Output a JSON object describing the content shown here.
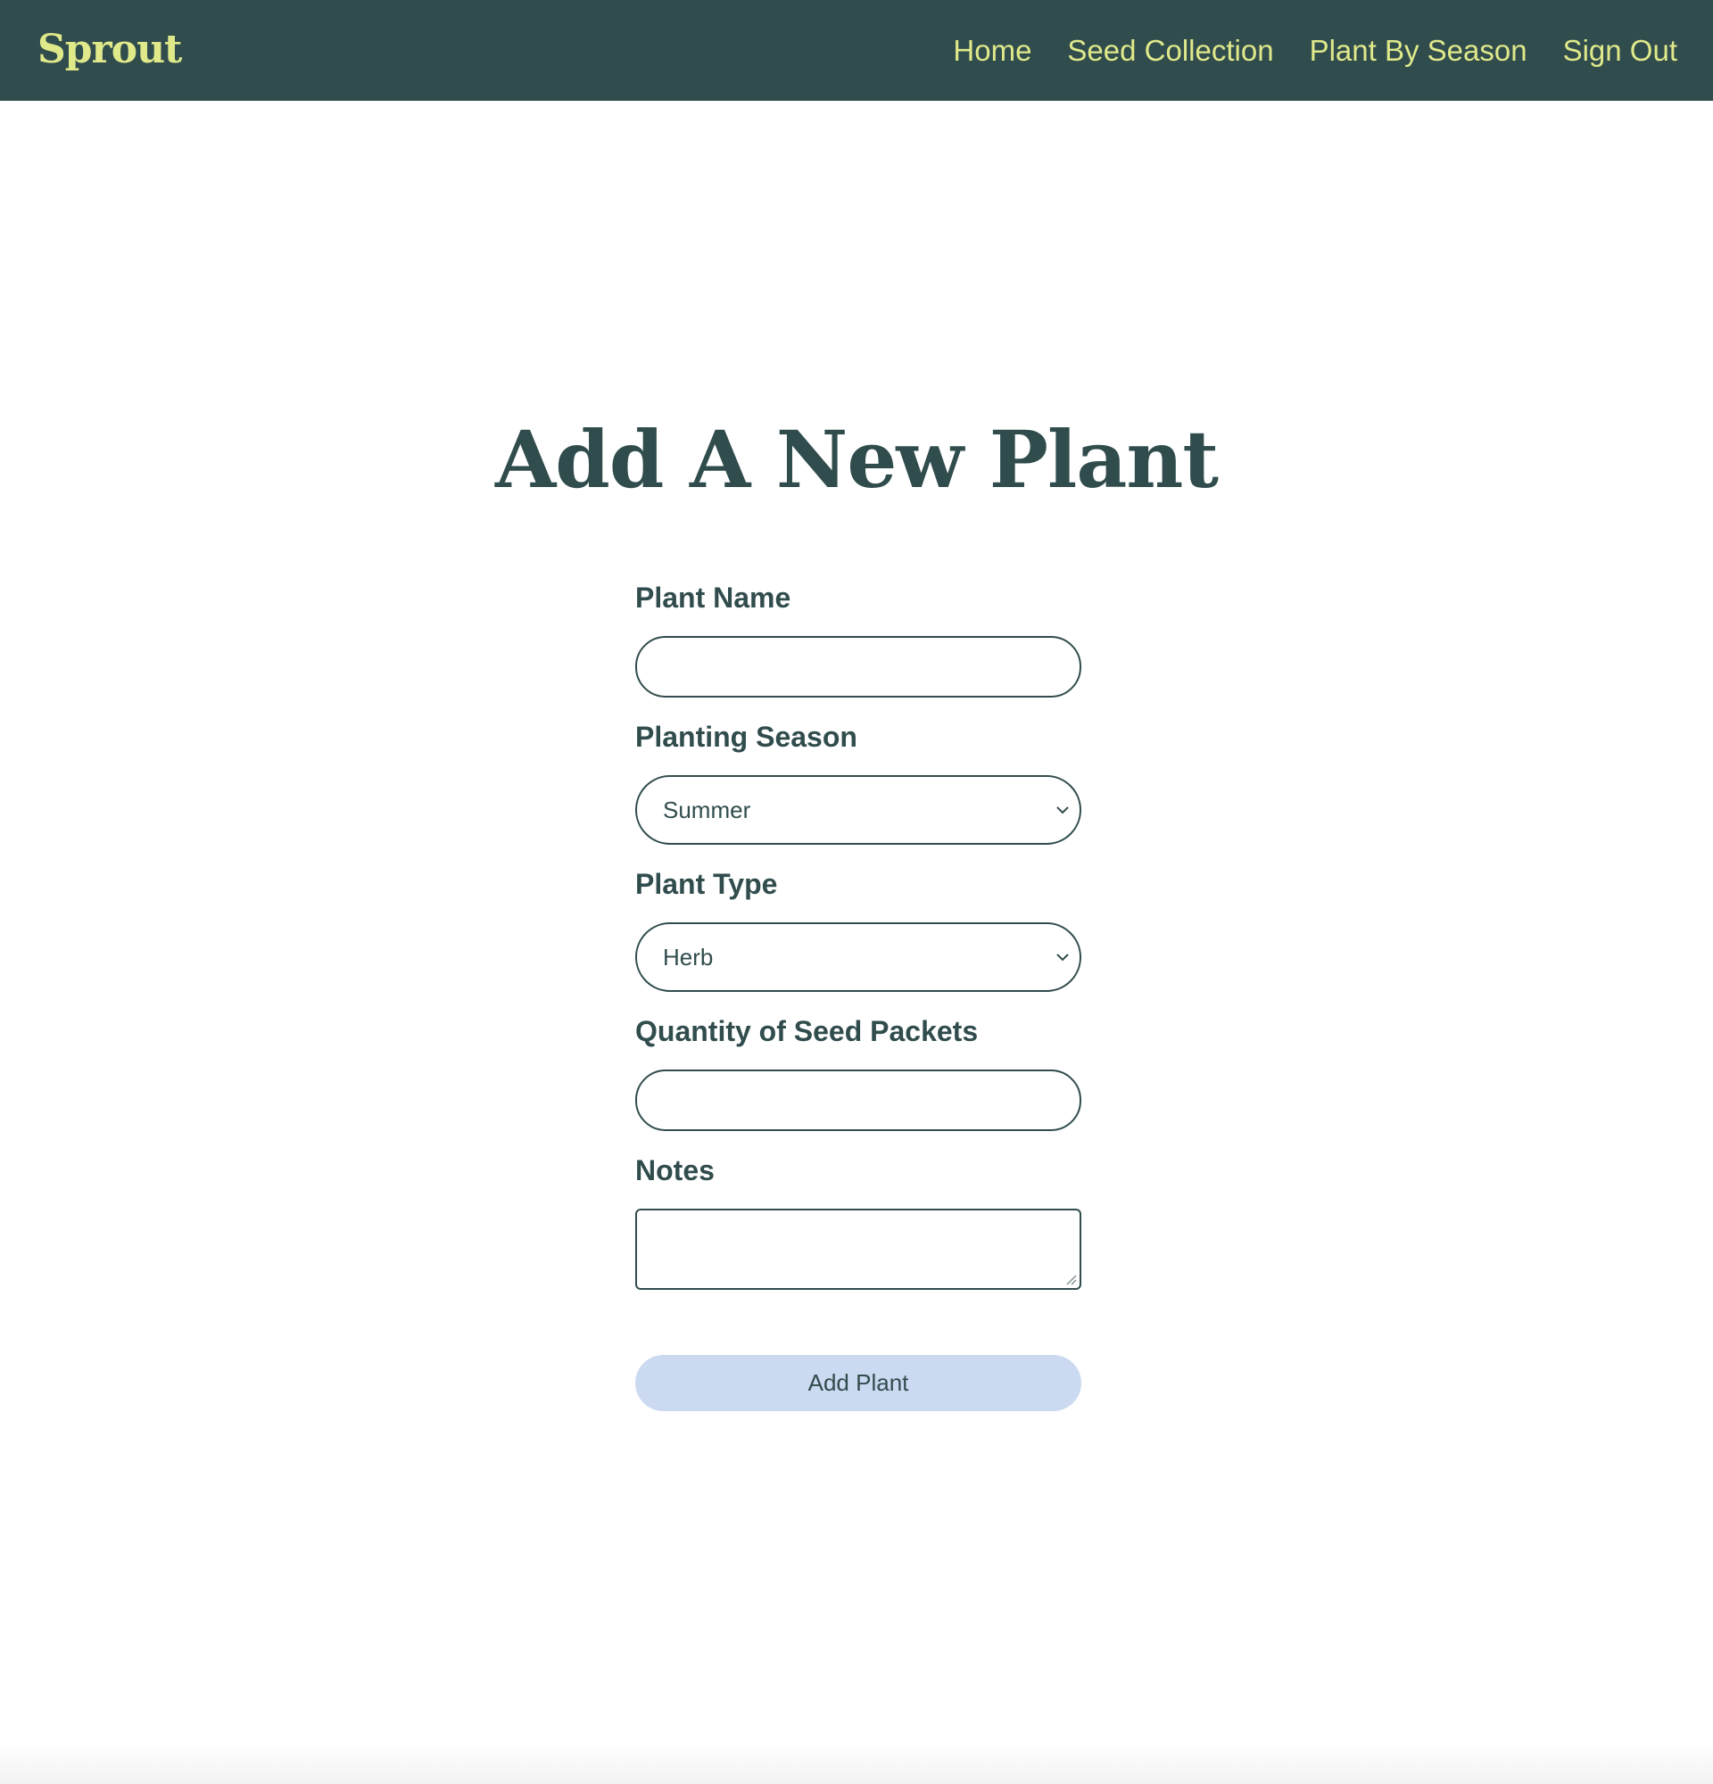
{
  "navbar": {
    "brand": "Sprout",
    "links": [
      "Home",
      "Seed Collection",
      "Plant By Season",
      "Sign Out"
    ]
  },
  "page": {
    "title": "Add A New Plant"
  },
  "form": {
    "plant_name": {
      "label": "Plant Name",
      "value": ""
    },
    "planting_season": {
      "label": "Planting Season",
      "selected": "Summer"
    },
    "plant_type": {
      "label": "Plant Type",
      "selected": "Herb"
    },
    "seed_quantity": {
      "label": "Quantity of Seed Packets",
      "value": ""
    },
    "notes": {
      "label": "Notes",
      "value": ""
    },
    "submit_label": "Add Plant"
  },
  "colors": {
    "primary": "#314c4d",
    "accent": "#dfe98a",
    "button_bg": "#cbd9f1",
    "background": "#ffffff"
  },
  "icons": {
    "select_arrow": "chevron-down-icon",
    "textarea_resize": "resize-grip-icon"
  }
}
